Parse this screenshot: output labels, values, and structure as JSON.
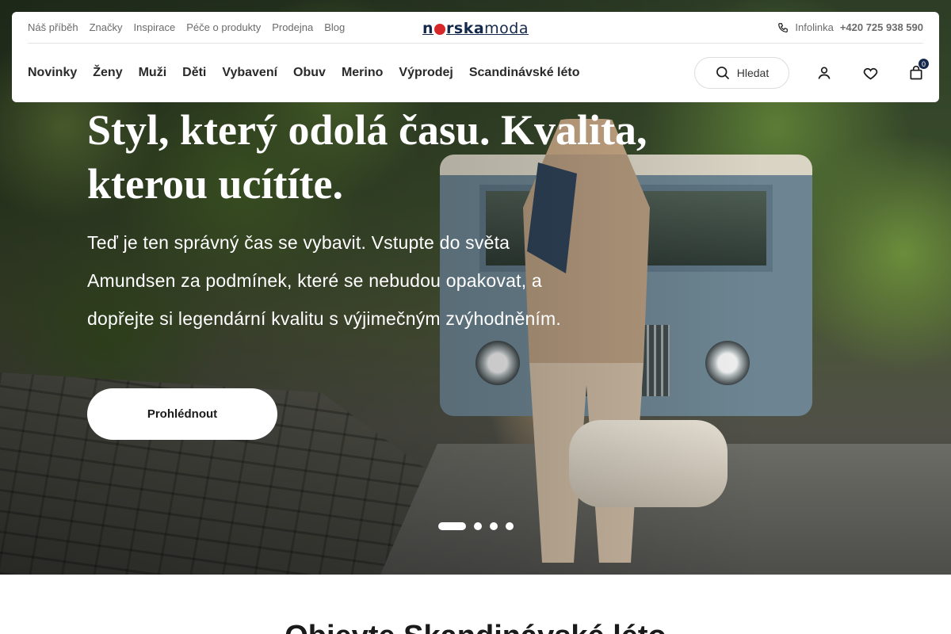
{
  "topbar": {
    "links": [
      "Náš příběh",
      "Značky",
      "Inspirace",
      "Péče o produkty",
      "Prodejna",
      "Blog"
    ],
    "logo": {
      "part1": "n",
      "part2": "rska",
      "part3": "moda"
    },
    "infoline_label": "Infolinka",
    "infoline_phone": "+420 725 938 590"
  },
  "nav": {
    "items": [
      "Novinky",
      "Ženy",
      "Muži",
      "Děti",
      "Vybavení",
      "Obuv",
      "Merino",
      "Výprodej",
      "Scandinávské léto"
    ],
    "search_label": "Hledat",
    "cart_count": "0"
  },
  "hero": {
    "title": "Styl, který odolá času. Kvalita, kterou ucítíte.",
    "subtitle": "Teď je ten správný čas se vybavit. Vstupte do světa Amundsen za podmínek, které se nebudou opakovat, a dopřejte si legendární kvalitu s výjimečným zvýhodněním.",
    "cta_label": "Prohlédnout",
    "slides_total": 4,
    "slide_active": 1
  },
  "section": {
    "title": "Objevte Skandinávské léto"
  },
  "colors": {
    "brand_navy": "#13284a",
    "brand_red": "#d62828"
  }
}
